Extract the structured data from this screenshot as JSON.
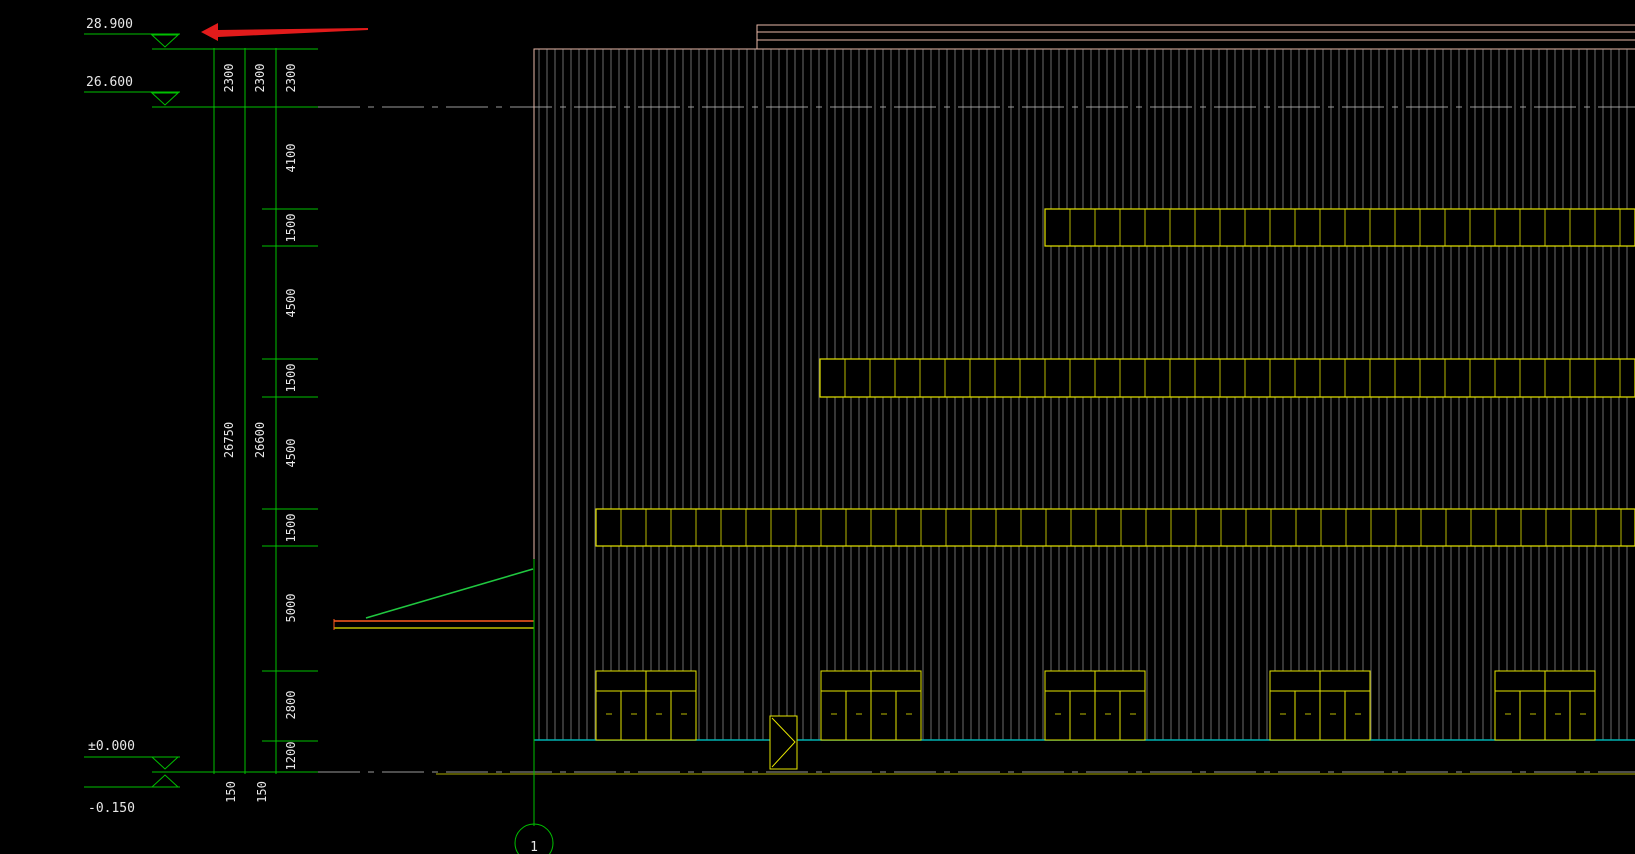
{
  "colors": {
    "background": "#000000",
    "dimension": "#00c000",
    "grid_line": "#9a9a9a",
    "facade": "#b4b4b4",
    "roof_outline": "#e8b7a7",
    "band": "#e6e600",
    "ground": "#00b0b0",
    "canopy_top": "#ff5a1f",
    "canopy_brace": "#20c840",
    "axis_line": "#00c000",
    "arrow": "#e21b1b",
    "text": "#e8e8e8"
  },
  "levels": {
    "top": "28.900",
    "eave": "26.600",
    "ground": "±0.000",
    "base": "-0.150"
  },
  "dimensions": {
    "right_chain": [
      "2300",
      "4100",
      "1500",
      "4500",
      "1500",
      "4500",
      "1500",
      "5000",
      "2800",
      "1200"
    ],
    "middle_chain": [
      "2300",
      "26600"
    ],
    "left_chain": [
      "2300",
      "26750"
    ],
    "bottom_pair": [
      "150",
      "150"
    ]
  },
  "axis": {
    "label": "1"
  },
  "icons": [
    "elevation-marker-icon",
    "red-arrow-icon",
    "door-swing-icon"
  ]
}
